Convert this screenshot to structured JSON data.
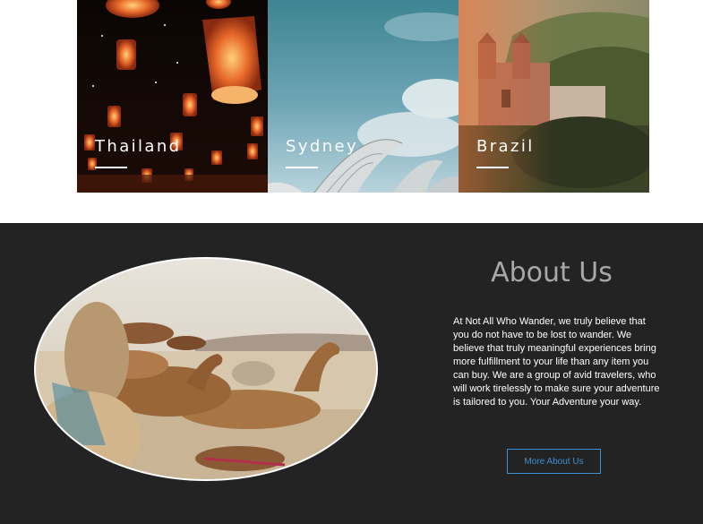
{
  "destinations": [
    {
      "label": "Thailand"
    },
    {
      "label": "Sydney"
    },
    {
      "label": "Brazil"
    }
  ],
  "about": {
    "title": "About Us",
    "body": "At Not All Who Wander, we truly believe that you do not have to be lost to wander. We believe that truly meaningful experiences bring more fulfillment to your life than any item you can buy. We are a group of avid travelers, who will work tirelessly to make sure your adventure is tailored  to you. Your Adventure your way.",
    "button_label": "More About Us"
  },
  "colors": {
    "section_bg": "#232323",
    "accent": "#3d8fd4",
    "title": "#a8a8a8"
  }
}
